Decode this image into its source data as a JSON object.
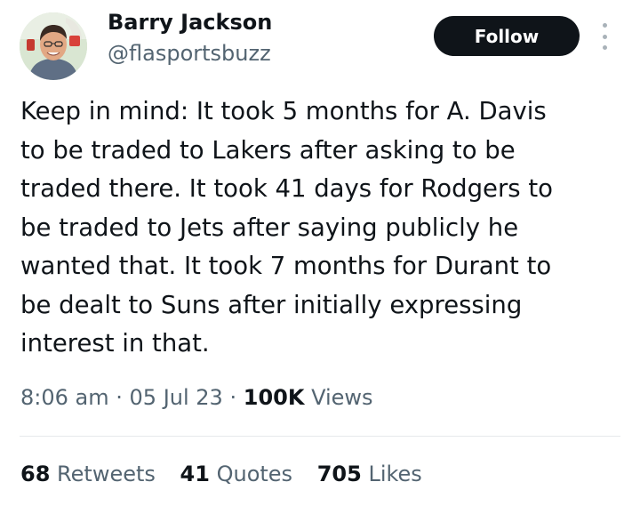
{
  "author": {
    "name": "Barry Jackson",
    "handle": "@flasportsbuzz",
    "avatar": "profile-photo"
  },
  "follow_label": "Follow",
  "more_icon": "more-options-icon",
  "tweet_text": "Keep in mind: It took 5 months for A. Davis\nto be traded to Lakers after asking to be\ntraded there. It took 41 days for Rodgers to\nbe traded to Jets after saying publicly he\nwanted that. It took 7 months for Durant to\nbe dealt to Suns after initially expressing\ninterest in that.",
  "meta": {
    "time": "8:06 am",
    "sep1": "·",
    "date": "05 Jul 23",
    "sep2": "·",
    "views_count": "100K",
    "views_label": "Views"
  },
  "stats": {
    "retweets_count": "68",
    "retweets_label": "Retweets",
    "quotes_count": "41",
    "quotes_label": "Quotes",
    "likes_count": "705",
    "likes_label": "Likes"
  },
  "colors": {
    "text_primary": "#0f1419",
    "text_secondary": "#536471",
    "button_bg": "#0f1419",
    "button_text": "#ffffff",
    "divider": "#e6e9eb"
  }
}
